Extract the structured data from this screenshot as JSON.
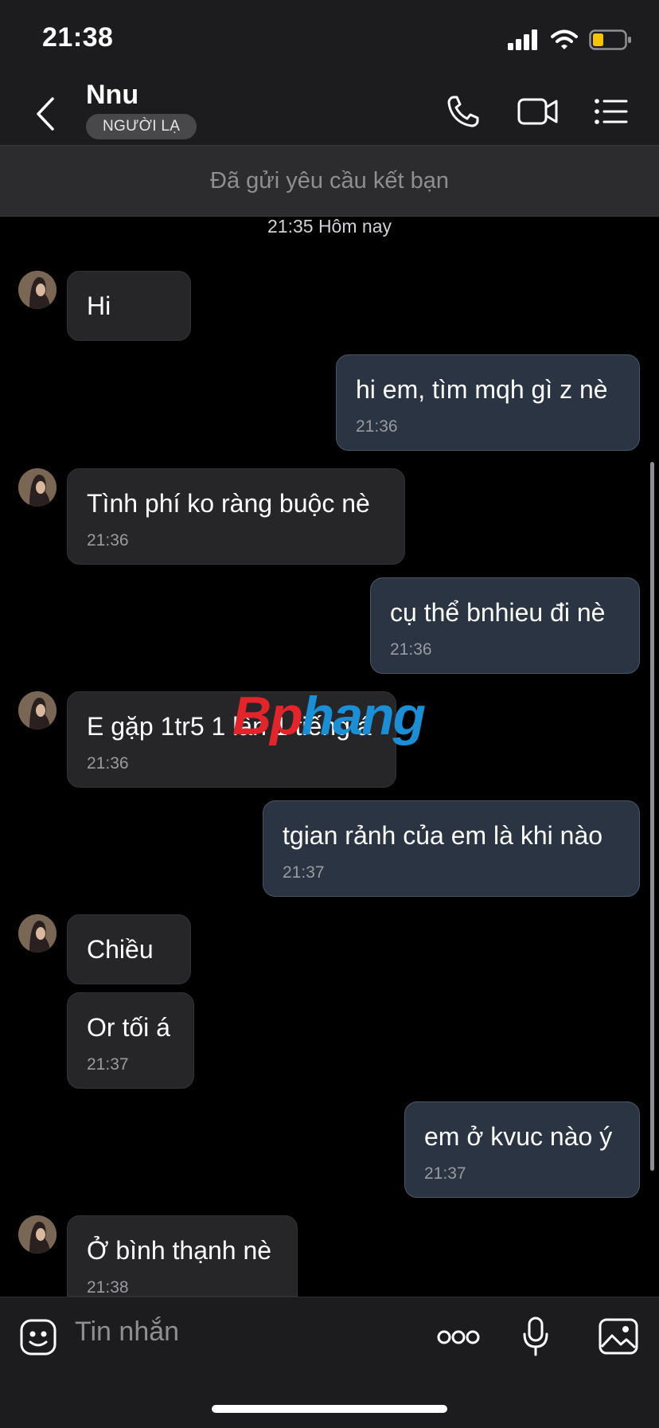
{
  "status_bar": {
    "time": "21:38",
    "signal_icon": "cellular-signal-icon",
    "wifi_icon": "wifi-icon",
    "battery_icon": "battery-low-icon",
    "battery_color": "#f5c400"
  },
  "header": {
    "contact_name": "Nnu",
    "badge": "NGƯỜI LẠ",
    "icons": [
      "back-chevron-icon",
      "phone-icon",
      "video-call-icon",
      "menu-list-icon"
    ]
  },
  "banner": {
    "text": "Đã gửi yêu cầu kết bạn"
  },
  "date_separator": "21:35 Hôm nay",
  "messages": [
    {
      "direction": "in",
      "text": "Hi",
      "time": ""
    },
    {
      "direction": "out",
      "text": "hi em, tìm mqh gì z nè",
      "time": "21:36"
    },
    {
      "direction": "in",
      "text": "Tình phí ko ràng buộc nè",
      "time": "21:36"
    },
    {
      "direction": "out",
      "text": "cụ thể bnhieu đi nè",
      "time": "21:36"
    },
    {
      "direction": "in",
      "text": "E gặp 1tr5 1 lần 1 tiếng á",
      "time": "21:36"
    },
    {
      "direction": "out",
      "text": "tgian rảnh của em là khi nào",
      "time": "21:37"
    },
    {
      "direction": "in",
      "text": "Chiều",
      "time": ""
    },
    {
      "direction": "in",
      "text": "Or tối á",
      "time": "21:37"
    },
    {
      "direction": "out",
      "text": "em ở kvuc nào ý",
      "time": "21:37"
    },
    {
      "direction": "in",
      "text": "Ở bình thạnh nè",
      "time": "21:38"
    }
  ],
  "watermark": {
    "text_red": "Bp",
    "text_blue": "hang"
  },
  "composer": {
    "placeholder": "Tin nhắn",
    "icons": [
      "emoji-sticker-icon",
      "more-options-icon",
      "microphone-icon",
      "image-gallery-icon"
    ]
  },
  "colors": {
    "background": "#000000",
    "bar": "#1c1c1e",
    "incoming_bubble": "#262628",
    "outgoing_bubble": "#2a3442"
  }
}
